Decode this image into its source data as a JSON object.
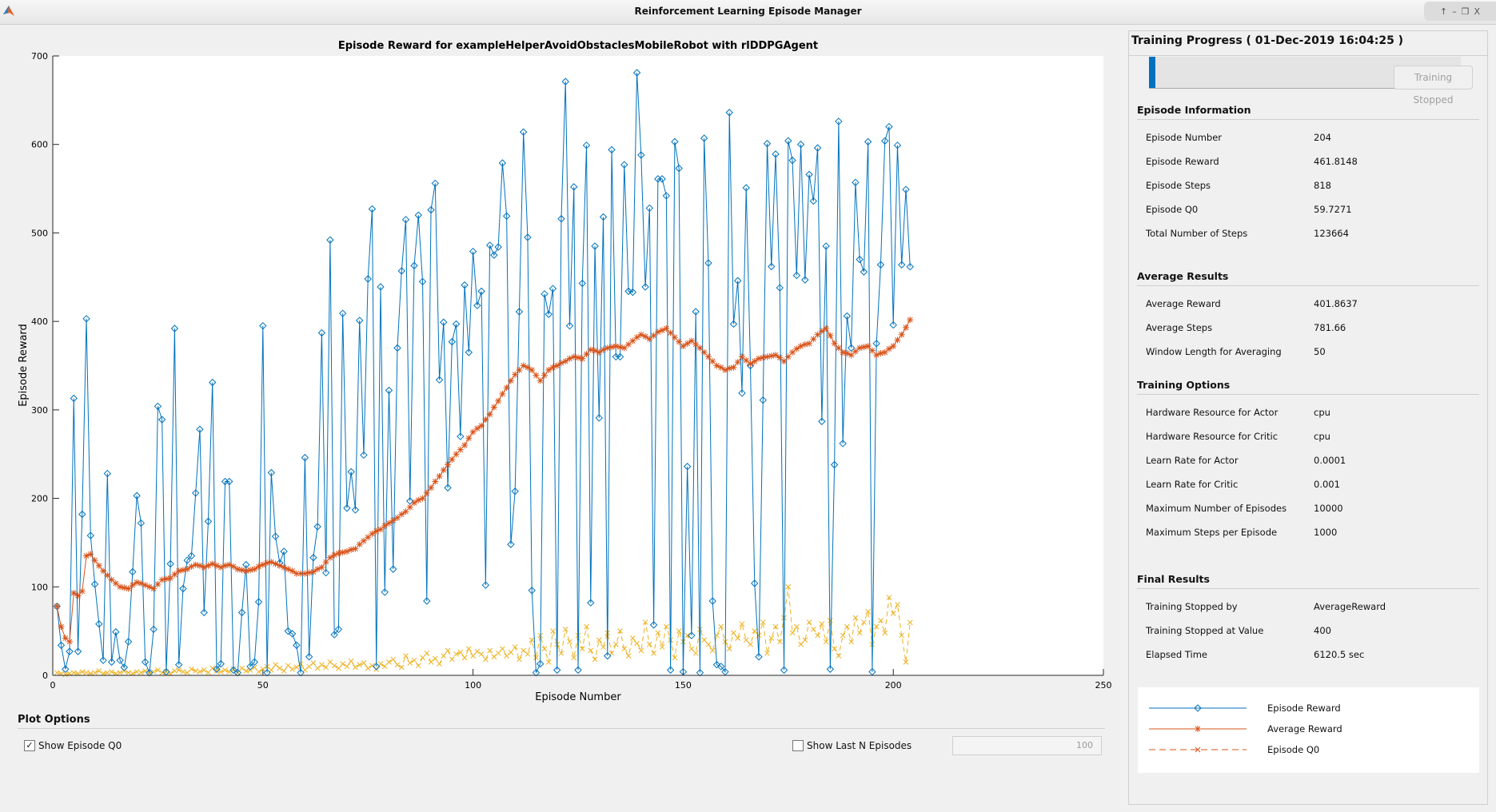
{
  "window": {
    "title": "Reinforcement Learning Episode Manager",
    "controls": [
      "↑",
      "–",
      "❐",
      "X"
    ]
  },
  "colors": {
    "episode_reward": "#0072BD",
    "average_reward": "#D95319",
    "episode_q0": "#EDB120",
    "progress": "#0072BD"
  },
  "chart_data": {
    "type": "line",
    "title": "Episode Reward for exampleHelperAvoidObstaclesMobileRobot with rlDDPGAgent",
    "xlabel": "Episode Number",
    "ylabel": "Episode Reward",
    "xlim": [
      0,
      250
    ],
    "ylim": [
      0,
      700
    ],
    "xticks": [
      "0",
      "50",
      "100",
      "150",
      "200",
      "250"
    ],
    "yticks": [
      "0",
      "100",
      "200",
      "300",
      "400",
      "500",
      "600",
      "700"
    ],
    "grid": false,
    "legend": "panel-bottom-right",
    "series": [
      {
        "name": "Episode Reward",
        "marker": "diamond",
        "line": "solid",
        "values": [
          78,
          34,
          7,
          27,
          313,
          27,
          182,
          403,
          158,
          103,
          58,
          17,
          228,
          15,
          49,
          17,
          9,
          38,
          117,
          203,
          172,
          15,
          3,
          52,
          304,
          289,
          4,
          126,
          392,
          12,
          98,
          130,
          135,
          206,
          278,
          71,
          174,
          331,
          7,
          13,
          219,
          219,
          6,
          3,
          71,
          125,
          10,
          15,
          83,
          395,
          3,
          229,
          157,
          127,
          140,
          50,
          47,
          34,
          3,
          246,
          21,
          133,
          168,
          387,
          116,
          492,
          46,
          52,
          409,
          189,
          230,
          187,
          401,
          249,
          448,
          527,
          10,
          439,
          94,
          322,
          120,
          370,
          457,
          515,
          197,
          463,
          520,
          445,
          84,
          526,
          556,
          334,
          399,
          212,
          377,
          397,
          270,
          441,
          365,
          479,
          418,
          434,
          102,
          486,
          475,
          484,
          579,
          519,
          148,
          208,
          411,
          614,
          495,
          96,
          3,
          13,
          431,
          408,
          437,
          6,
          516,
          671,
          395,
          552,
          6,
          443,
          599,
          82,
          485,
          291,
          518,
          22,
          594,
          360,
          360,
          577,
          434,
          433,
          681,
          588,
          439,
          528,
          57,
          561,
          561,
          542,
          6,
          603,
          573,
          4,
          236,
          45,
          411,
          3,
          607,
          466,
          84,
          12,
          10,
          4,
          636,
          397,
          446,
          319,
          551,
          350,
          104,
          21,
          311,
          601,
          462,
          589,
          438,
          6,
          604,
          582,
          452,
          600,
          447,
          566,
          536,
          596,
          287,
          485,
          7,
          238,
          626,
          262,
          406,
          370,
          557,
          470,
          456,
          603,
          4,
          375,
          464,
          604,
          620,
          396,
          599,
          464,
          549,
          461.8148
        ]
      },
      {
        "name": "Average Reward",
        "marker": "asterisk",
        "line": "solid",
        "values": [
          78,
          55,
          42,
          38,
          93,
          90,
          95,
          135,
          137,
          130,
          124,
          118,
          113,
          108,
          104,
          100,
          99,
          98,
          102,
          105,
          104,
          102,
          100,
          98,
          103,
          108,
          109,
          110,
          114,
          118,
          119,
          120,
          123,
          125,
          124,
          122,
          124,
          126,
          124,
          122,
          124,
          125,
          123,
          120,
          119,
          118,
          119,
          120,
          123,
          125,
          127,
          128,
          126,
          124,
          122,
          120,
          118,
          115,
          115,
          115,
          116,
          117,
          120,
          122,
          128,
          133,
          136,
          138,
          139,
          140,
          142,
          143,
          148,
          152,
          156,
          160,
          163,
          165,
          169,
          172,
          175,
          178,
          182,
          185,
          190,
          195,
          198,
          200,
          206,
          212,
          219,
          225,
          232,
          238,
          244,
          250,
          255,
          260,
          268,
          275,
          279,
          282,
          289,
          295,
          303,
          310,
          318,
          325,
          333,
          340,
          345,
          350,
          348,
          345,
          339,
          333,
          339,
          345,
          348,
          350,
          353,
          355,
          358,
          360,
          359,
          358,
          363,
          368,
          367,
          365,
          368,
          370,
          371,
          372,
          371,
          370,
          374,
          378,
          382,
          385,
          383,
          380,
          384,
          388,
          390,
          392,
          387,
          382,
          377,
          372,
          375,
          378,
          374,
          370,
          365,
          360,
          355,
          350,
          348,
          345,
          347,
          348,
          354,
          360,
          356,
          352,
          355,
          358,
          359,
          360,
          361,
          362,
          359,
          355,
          360,
          365,
          369,
          372,
          374,
          375,
          380,
          385,
          389,
          392,
          384,
          375,
          370,
          365,
          364,
          362,
          366,
          370,
          371,
          372,
          367,
          362,
          364,
          365,
          369,
          372,
          379,
          385,
          393,
          401.8637
        ]
      },
      {
        "name": "Episode Q0",
        "marker": "x",
        "line": "dashed",
        "values": [
          3,
          2,
          1,
          2,
          3,
          2,
          4,
          3,
          2,
          3,
          5,
          2,
          3,
          4,
          2,
          3,
          5,
          3,
          2,
          4,
          3,
          5,
          2,
          4,
          6,
          3,
          4,
          2,
          5,
          6,
          4,
          3,
          7,
          5,
          4,
          6,
          3,
          8,
          5,
          4,
          6,
          4,
          7,
          3,
          8,
          5,
          6,
          9,
          4,
          7,
          10,
          6,
          12,
          8,
          5,
          11,
          7,
          9,
          13,
          6,
          10,
          14,
          8,
          12,
          9,
          15,
          11,
          8,
          13,
          10,
          16,
          9,
          12,
          14,
          8,
          11,
          7,
          13,
          10,
          15,
          18,
          12,
          9,
          22,
          14,
          17,
          11,
          20,
          25,
          15,
          19,
          13,
          22,
          28,
          18,
          24,
          26,
          20,
          30,
          22,
          27,
          24,
          18,
          28,
          21,
          25,
          30,
          22,
          26,
          32,
          18,
          28,
          24,
          40,
          20,
          45,
          30,
          15,
          50,
          35,
          25,
          52,
          38,
          20,
          45,
          30,
          55,
          28,
          18,
          40,
          32,
          48,
          25,
          35,
          50,
          30,
          22,
          42,
          36,
          28,
          60,
          35,
          25,
          48,
          32,
          55,
          40,
          20,
          50,
          38,
          45,
          30,
          25,
          52,
          40,
          35,
          28,
          45,
          55,
          38,
          30,
          48,
          42,
          58,
          40,
          35,
          50,
          45,
          60,
          25,
          42,
          55,
          38,
          65,
          100,
          48,
          55,
          35,
          40,
          60,
          52,
          45,
          58,
          38,
          62,
          30,
          22,
          45,
          55,
          38,
          65,
          48,
          60,
          72,
          35,
          55,
          62,
          48,
          88,
          70,
          80,
          45,
          15,
          59.7271
        ]
      }
    ]
  },
  "plot_options": {
    "title": "Plot Options",
    "show_q0": {
      "label": "Show Episode Q0",
      "checked": true,
      "mark": "✓"
    },
    "show_last_n": {
      "label": "Show Last N Episodes",
      "checked": false,
      "value": "100"
    }
  },
  "panel": {
    "title": "Training Progress ( 01-Dec-2019 16:04:25 )",
    "progress_fraction": 0.0204,
    "stop_button": "Training Stopped",
    "episode_info": {
      "title": "Episode Information",
      "rows": [
        {
          "label": "Episode Number",
          "value": "204"
        },
        {
          "label": "Episode Reward",
          "value": "461.8148"
        },
        {
          "label": "Episode Steps",
          "value": "818"
        },
        {
          "label": "Episode Q0",
          "value": "59.7271"
        },
        {
          "label": "Total Number of Steps",
          "value": "123664"
        }
      ]
    },
    "average_results": {
      "title": "Average Results",
      "rows": [
        {
          "label": "Average Reward",
          "value": "401.8637"
        },
        {
          "label": "Average Steps",
          "value": "781.66"
        },
        {
          "label": "Window Length for Averaging",
          "value": "50"
        }
      ]
    },
    "training_options": {
      "title": "Training Options",
      "rows": [
        {
          "label": "Hardware Resource for Actor",
          "value": "cpu"
        },
        {
          "label": "Hardware Resource for Critic",
          "value": "cpu"
        },
        {
          "label": "Learn Rate for Actor",
          "value": "0.0001"
        },
        {
          "label": "Learn Rate for Critic",
          "value": "0.001"
        },
        {
          "label": "Maximum Number of Episodes",
          "value": "10000"
        },
        {
          "label": "Maximum Steps per Episode",
          "value": "1000"
        }
      ]
    },
    "final_results": {
      "title": "Final Results",
      "rows": [
        {
          "label": "Training Stopped by",
          "value": "AverageReward"
        },
        {
          "label": "Training Stopped at Value",
          "value": "400"
        },
        {
          "label": "Elapsed Time",
          "value": "6120.5 sec"
        }
      ]
    },
    "legend": [
      {
        "label": "Episode Reward"
      },
      {
        "label": "Average Reward"
      },
      {
        "label": "Episode Q0"
      }
    ]
  }
}
